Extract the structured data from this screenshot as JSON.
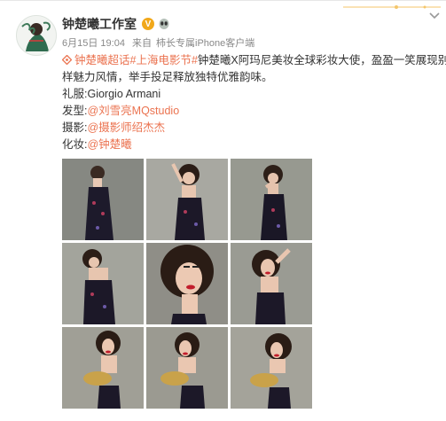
{
  "post": {
    "author": "钟楚曦工作室",
    "date": "6月15日 19:04",
    "source_prefix": "来自",
    "source": "柿长专属iPhone客户端",
    "line1_topic": "钟楚曦超话",
    "line1_hashtag": "#上海电影节#",
    "line1_rest": "钟楚曦X阿玛尼美妆全球彩妆大使，盈盈一笑展现别",
    "line2": "样魅力风情，举手投足释放独特优雅韵味。",
    "outfit_label": "礼服:",
    "outfit_value": "Giorgio Armani",
    "hair_label": "发型:",
    "hair_mention": "@刘雪亮MQstudio",
    "photo_label": "摄影:",
    "photo_mention": "@摄影师绍杰杰",
    "makeup_label": "化妆:",
    "makeup_mention": "@钟楚曦"
  },
  "icons": {
    "verified": "verified-v-badge",
    "alien": "alien-emoji-icon",
    "topic": "super-topic-icon",
    "chevron": "chevron-down-icon"
  },
  "colors": {
    "link": "#eb7350",
    "meta": "#888888",
    "badge": "#f1a81b"
  },
  "badge_letter": "V",
  "photos": [
    {
      "pose": "standing-full"
    },
    {
      "pose": "arm-up"
    },
    {
      "pose": "hand-chin"
    },
    {
      "pose": "shoulder"
    },
    {
      "pose": "closeup-red-lips"
    },
    {
      "pose": "hand-behind-head"
    },
    {
      "pose": "clutch-1"
    },
    {
      "pose": "clutch-2"
    },
    {
      "pose": "clutch-3"
    }
  ]
}
